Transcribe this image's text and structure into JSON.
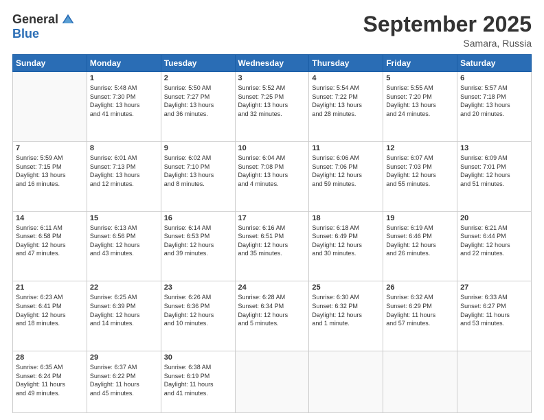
{
  "header": {
    "logo_general": "General",
    "logo_blue": "Blue",
    "month_title": "September 2025",
    "location": "Samara, Russia"
  },
  "days_of_week": [
    "Sunday",
    "Monday",
    "Tuesday",
    "Wednesday",
    "Thursday",
    "Friday",
    "Saturday"
  ],
  "weeks": [
    [
      {
        "day": "",
        "info": ""
      },
      {
        "day": "1",
        "info": "Sunrise: 5:48 AM\nSunset: 7:30 PM\nDaylight: 13 hours\nand 41 minutes."
      },
      {
        "day": "2",
        "info": "Sunrise: 5:50 AM\nSunset: 7:27 PM\nDaylight: 13 hours\nand 36 minutes."
      },
      {
        "day": "3",
        "info": "Sunrise: 5:52 AM\nSunset: 7:25 PM\nDaylight: 13 hours\nand 32 minutes."
      },
      {
        "day": "4",
        "info": "Sunrise: 5:54 AM\nSunset: 7:22 PM\nDaylight: 13 hours\nand 28 minutes."
      },
      {
        "day": "5",
        "info": "Sunrise: 5:55 AM\nSunset: 7:20 PM\nDaylight: 13 hours\nand 24 minutes."
      },
      {
        "day": "6",
        "info": "Sunrise: 5:57 AM\nSunset: 7:18 PM\nDaylight: 13 hours\nand 20 minutes."
      }
    ],
    [
      {
        "day": "7",
        "info": "Sunrise: 5:59 AM\nSunset: 7:15 PM\nDaylight: 13 hours\nand 16 minutes."
      },
      {
        "day": "8",
        "info": "Sunrise: 6:01 AM\nSunset: 7:13 PM\nDaylight: 13 hours\nand 12 minutes."
      },
      {
        "day": "9",
        "info": "Sunrise: 6:02 AM\nSunset: 7:10 PM\nDaylight: 13 hours\nand 8 minutes."
      },
      {
        "day": "10",
        "info": "Sunrise: 6:04 AM\nSunset: 7:08 PM\nDaylight: 13 hours\nand 4 minutes."
      },
      {
        "day": "11",
        "info": "Sunrise: 6:06 AM\nSunset: 7:06 PM\nDaylight: 12 hours\nand 59 minutes."
      },
      {
        "day": "12",
        "info": "Sunrise: 6:07 AM\nSunset: 7:03 PM\nDaylight: 12 hours\nand 55 minutes."
      },
      {
        "day": "13",
        "info": "Sunrise: 6:09 AM\nSunset: 7:01 PM\nDaylight: 12 hours\nand 51 minutes."
      }
    ],
    [
      {
        "day": "14",
        "info": "Sunrise: 6:11 AM\nSunset: 6:58 PM\nDaylight: 12 hours\nand 47 minutes."
      },
      {
        "day": "15",
        "info": "Sunrise: 6:13 AM\nSunset: 6:56 PM\nDaylight: 12 hours\nand 43 minutes."
      },
      {
        "day": "16",
        "info": "Sunrise: 6:14 AM\nSunset: 6:53 PM\nDaylight: 12 hours\nand 39 minutes."
      },
      {
        "day": "17",
        "info": "Sunrise: 6:16 AM\nSunset: 6:51 PM\nDaylight: 12 hours\nand 35 minutes."
      },
      {
        "day": "18",
        "info": "Sunrise: 6:18 AM\nSunset: 6:49 PM\nDaylight: 12 hours\nand 30 minutes."
      },
      {
        "day": "19",
        "info": "Sunrise: 6:19 AM\nSunset: 6:46 PM\nDaylight: 12 hours\nand 26 minutes."
      },
      {
        "day": "20",
        "info": "Sunrise: 6:21 AM\nSunset: 6:44 PM\nDaylight: 12 hours\nand 22 minutes."
      }
    ],
    [
      {
        "day": "21",
        "info": "Sunrise: 6:23 AM\nSunset: 6:41 PM\nDaylight: 12 hours\nand 18 minutes."
      },
      {
        "day": "22",
        "info": "Sunrise: 6:25 AM\nSunset: 6:39 PM\nDaylight: 12 hours\nand 14 minutes."
      },
      {
        "day": "23",
        "info": "Sunrise: 6:26 AM\nSunset: 6:36 PM\nDaylight: 12 hours\nand 10 minutes."
      },
      {
        "day": "24",
        "info": "Sunrise: 6:28 AM\nSunset: 6:34 PM\nDaylight: 12 hours\nand 5 minutes."
      },
      {
        "day": "25",
        "info": "Sunrise: 6:30 AM\nSunset: 6:32 PM\nDaylight: 12 hours\nand 1 minute."
      },
      {
        "day": "26",
        "info": "Sunrise: 6:32 AM\nSunset: 6:29 PM\nDaylight: 11 hours\nand 57 minutes."
      },
      {
        "day": "27",
        "info": "Sunrise: 6:33 AM\nSunset: 6:27 PM\nDaylight: 11 hours\nand 53 minutes."
      }
    ],
    [
      {
        "day": "28",
        "info": "Sunrise: 6:35 AM\nSunset: 6:24 PM\nDaylight: 11 hours\nand 49 minutes."
      },
      {
        "day": "29",
        "info": "Sunrise: 6:37 AM\nSunset: 6:22 PM\nDaylight: 11 hours\nand 45 minutes."
      },
      {
        "day": "30",
        "info": "Sunrise: 6:38 AM\nSunset: 6:19 PM\nDaylight: 11 hours\nand 41 minutes."
      },
      {
        "day": "",
        "info": ""
      },
      {
        "day": "",
        "info": ""
      },
      {
        "day": "",
        "info": ""
      },
      {
        "day": "",
        "info": ""
      }
    ]
  ]
}
